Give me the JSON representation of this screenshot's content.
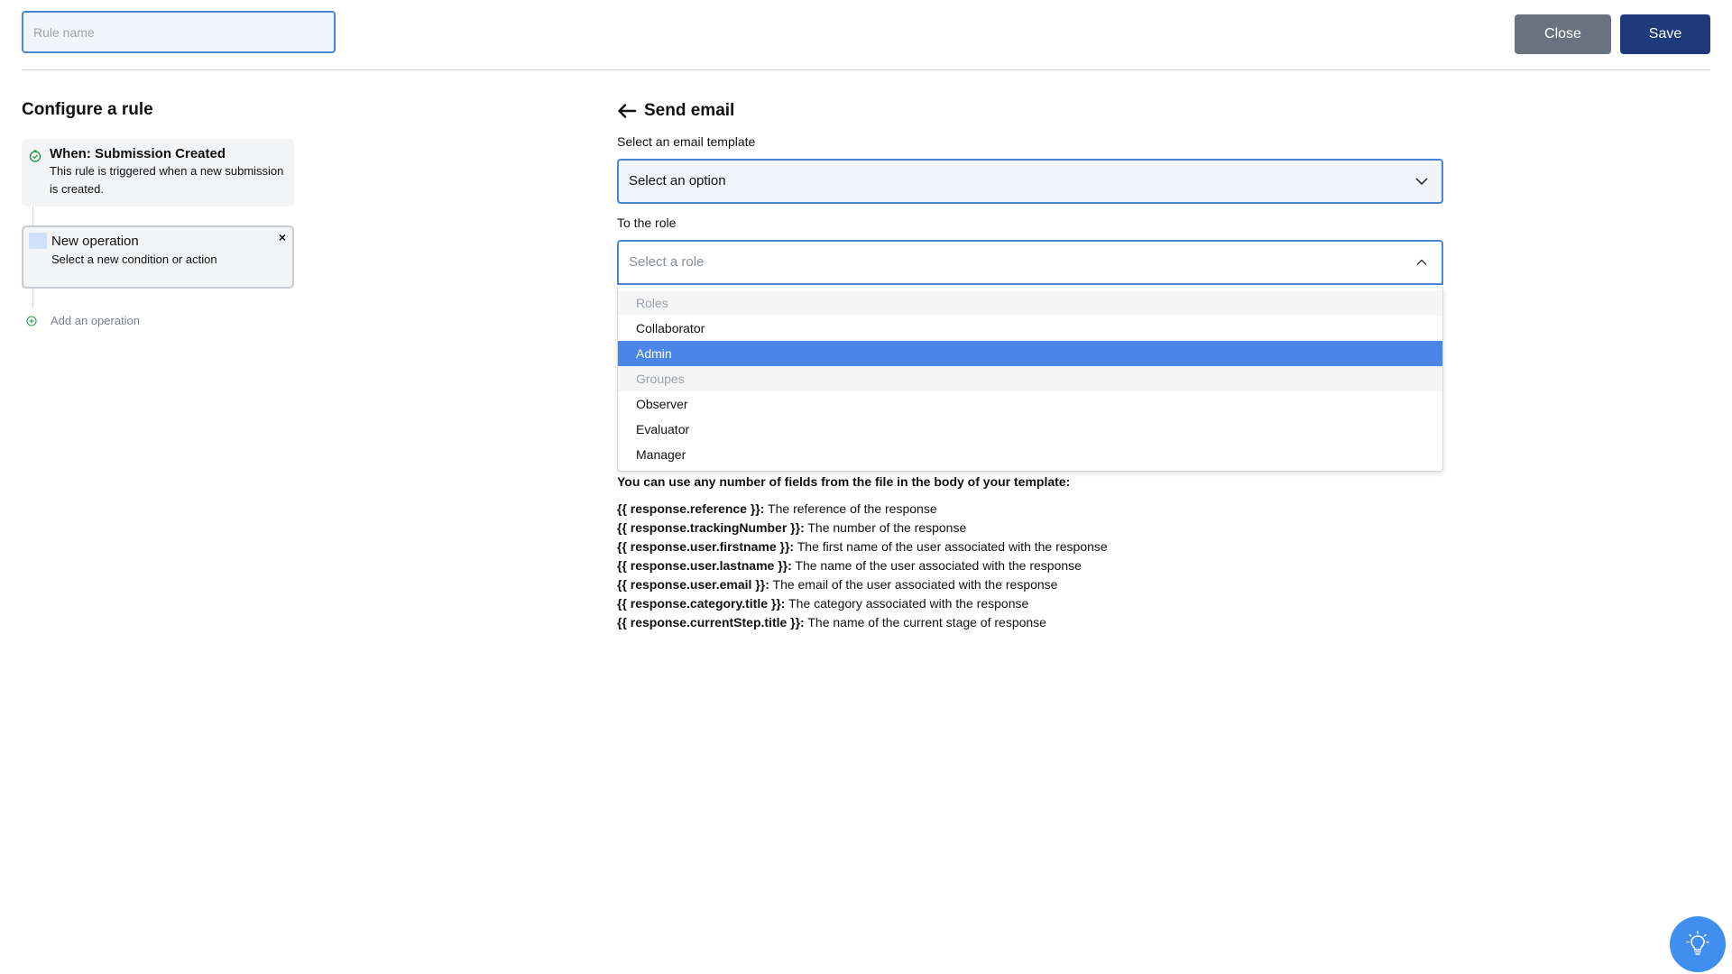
{
  "header": {
    "rule_name_placeholder": "Rule name",
    "close_label": "Close",
    "save_label": "Save"
  },
  "left": {
    "title": "Configure a rule",
    "trigger": {
      "title": "When: Submission Created",
      "description": "This rule is triggered when a new submission is created.",
      "icon": "clock-check-icon",
      "icon_color": "#2e9b4e"
    },
    "operation": {
      "title": "New operation",
      "description": "Select a new condition or action",
      "close_glyph": "×"
    },
    "add_operation_label": "Add an operation"
  },
  "right": {
    "title": "Send email",
    "template_label": "Select an email template",
    "template_value": "Select an option",
    "role_label": "To the role",
    "role_placeholder": "Select a role",
    "role_options": [
      {
        "label": "Roles",
        "type": "group"
      },
      {
        "label": "Collaborator",
        "type": "option"
      },
      {
        "label": "Admin",
        "type": "option",
        "selected": true
      },
      {
        "label": "Groupes",
        "type": "group"
      },
      {
        "label": "Observer",
        "type": "option"
      },
      {
        "label": "Evaluator",
        "type": "option"
      },
      {
        "label": "Manager",
        "type": "option"
      }
    ],
    "help_intro": "You can use any number of fields from the file in the body of your template:",
    "fields": [
      {
        "key": "{{ response.reference }}:",
        "desc": " The reference of the response"
      },
      {
        "key": "{{ response.trackingNumber }}:",
        "desc": " The number of the response"
      },
      {
        "key": "{{ response.user.firstname }}:",
        "desc": " The first name of the user associated with the response"
      },
      {
        "key": "{{ response.user.lastname }}:",
        "desc": " The name of the user associated with the response"
      },
      {
        "key": "{{ response.user.email }}:",
        "desc": " The email of the user associated with the response"
      },
      {
        "key": "{{ response.category.title }}:",
        "desc": " The category associated with the response"
      },
      {
        "key": "{{ response.currentStep.title }}:",
        "desc": " The name of the current stage of response"
      }
    ]
  },
  "colors": {
    "accent": "#4a86d6",
    "selected": "#4a86e8",
    "save": "#1e3a7b",
    "close": "#687280",
    "fab": "#3f8ef0"
  },
  "fab_icon": "lightbulb-icon"
}
